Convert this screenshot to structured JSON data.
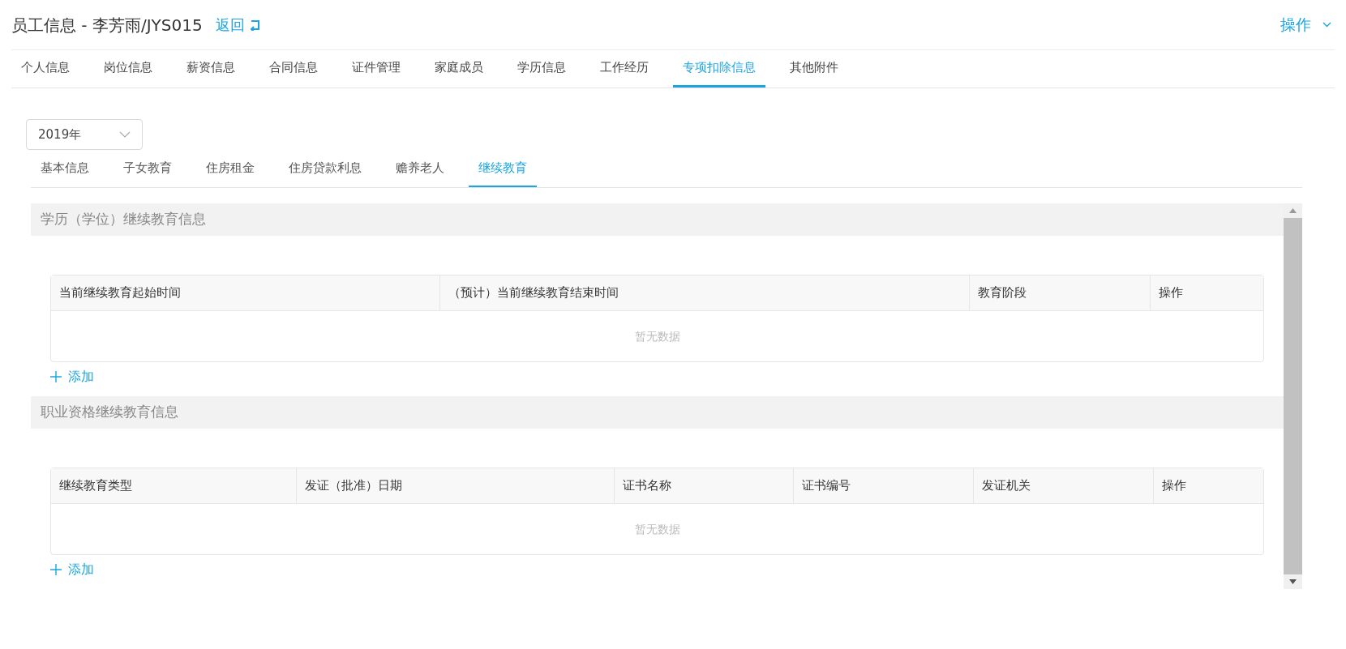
{
  "header": {
    "title": "员工信息 - 李芳雨/JYS015",
    "back_link": "返回",
    "actions": "操作"
  },
  "tabs": [
    {
      "label": "个人信息",
      "selected": false
    },
    {
      "label": "岗位信息",
      "selected": false
    },
    {
      "label": "薪资信息",
      "selected": false
    },
    {
      "label": "合同信息",
      "selected": false
    },
    {
      "label": "证件管理",
      "selected": false
    },
    {
      "label": "家庭成员",
      "selected": false
    },
    {
      "label": "学历信息",
      "selected": false
    },
    {
      "label": "工作经历",
      "selected": false
    },
    {
      "label": "专项扣除信息",
      "selected": true
    },
    {
      "label": "其他附件",
      "selected": false
    }
  ],
  "year_select": {
    "value": "2019年"
  },
  "sub_tabs": [
    {
      "label": "基本信息",
      "selected": false
    },
    {
      "label": "子女教育",
      "selected": false
    },
    {
      "label": "住房租金",
      "selected": false
    },
    {
      "label": "住房贷款利息",
      "selected": false
    },
    {
      "label": "赡养老人",
      "selected": false
    },
    {
      "label": "继续教育",
      "selected": true
    }
  ],
  "sections": [
    {
      "title": "学历（学位）继续教育信息",
      "columns": [
        {
          "label": "当前继续教育起始时间"
        },
        {
          "label": "（预计）当前继续教育结束时间"
        },
        {
          "label": "教育阶段"
        },
        {
          "label": "操作"
        }
      ],
      "empty_text": "暂无数据",
      "add_link": "添加"
    },
    {
      "title": "职业资格继续教育信息",
      "columns": [
        {
          "label": "继续教育类型"
        },
        {
          "label": "发证（批准）日期"
        },
        {
          "label": "证书名称"
        },
        {
          "label": "证书编号"
        },
        {
          "label": "发证机关"
        },
        {
          "label": "操作"
        }
      ],
      "empty_text": "暂无数据",
      "add_link": "添加"
    }
  ]
}
